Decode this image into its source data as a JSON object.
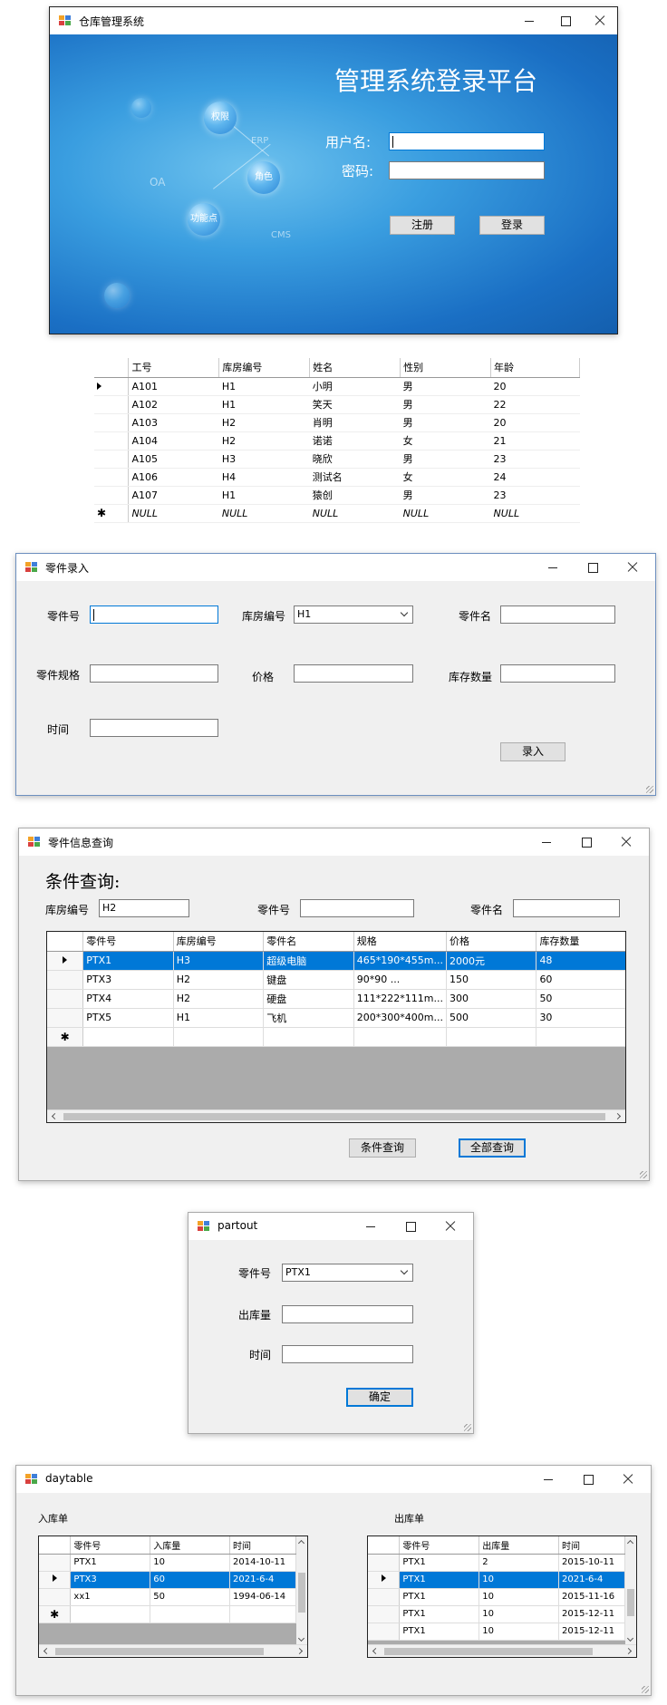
{
  "login": {
    "title": "仓库管理系统",
    "heading": "管理系统登录平台",
    "username_label": "用户名:",
    "password_label": "密码:",
    "register_label": "注册",
    "login_label": "登录",
    "bubbles": [
      "权限",
      "角色",
      "功能点"
    ],
    "faint": [
      "ERP",
      "OA",
      "CMS"
    ]
  },
  "staff_grid": {
    "columns": [
      "工号",
      "库房编号",
      "姓名",
      "性别",
      "年龄"
    ],
    "rows": [
      [
        "A101",
        "H1",
        "小明",
        "男",
        "20"
      ],
      [
        "A102",
        "H1",
        "笑天",
        "男",
        "22"
      ],
      [
        "A103",
        "H2",
        "肖明",
        "男",
        "20"
      ],
      [
        "A104",
        "H2",
        "诺诺",
        "女",
        "21"
      ],
      [
        "A105",
        "H3",
        "晓欣",
        "男",
        "23"
      ],
      [
        "A106",
        "H4",
        "测试名",
        "女",
        "24"
      ],
      [
        "A107",
        "H1",
        "猿创",
        "男",
        "23"
      ]
    ],
    "null_text": "NULL"
  },
  "part_entry": {
    "title": "零件录入",
    "part_no_label": "零件号",
    "warehouse_label": "库房编号",
    "warehouse_value": "H1",
    "part_name_label": "零件名",
    "spec_label": "零件规格",
    "price_label": "价格",
    "stock_label": "库存数量",
    "time_label": "时间",
    "submit_label": "录入"
  },
  "part_query": {
    "title": "零件信息查询",
    "heading": "条件查询:",
    "warehouse_label": "库房编号",
    "warehouse_value": "H2",
    "part_no_label": "零件号",
    "part_name_label": "零件名",
    "columns": [
      "零件号",
      "库房编号",
      "零件名",
      "规格",
      "价格",
      "库存数量"
    ],
    "rows": [
      [
        "PTX1",
        "H3",
        "超级电脑",
        "465*190*455m...",
        "2000元",
        "48"
      ],
      [
        "PTX3",
        "H2",
        "键盘",
        "90*90          ...",
        "150",
        "60"
      ],
      [
        "PTX4",
        "H2",
        "硬盘",
        "111*222*111m...",
        "300",
        "50"
      ],
      [
        "PTX5",
        "H1",
        "飞机",
        "200*300*400m...",
        "500",
        "30"
      ]
    ],
    "cond_button": "条件查询",
    "all_button": "全部查询"
  },
  "partout": {
    "title": "partout",
    "part_no_label": "零件号",
    "part_no_value": "PTX1",
    "qty_label": "出库量",
    "time_label": "时间",
    "ok_label": "确定"
  },
  "daytable": {
    "title": "daytable",
    "in_label": "入库单",
    "out_label": "出库单",
    "in_columns": [
      "零件号",
      "入库量",
      "时间"
    ],
    "in_rows": [
      [
        "PTX1",
        "10",
        "2014-10-11"
      ],
      [
        "PTX3",
        "60",
        "2021-6-4"
      ],
      [
        "xx1",
        "50",
        "1994-06-14"
      ]
    ],
    "out_columns": [
      "零件号",
      "出库量",
      "时间"
    ],
    "out_rows": [
      [
        "PTX1",
        "2",
        "2015-10-11"
      ],
      [
        "PTX1",
        "10",
        "2021-6-4"
      ],
      [
        "PTX1",
        "10",
        "2015-11-16"
      ],
      [
        "PTX1",
        "10",
        "2015-12-11"
      ],
      [
        "PTX1",
        "10",
        "2015-12-11"
      ]
    ]
  }
}
